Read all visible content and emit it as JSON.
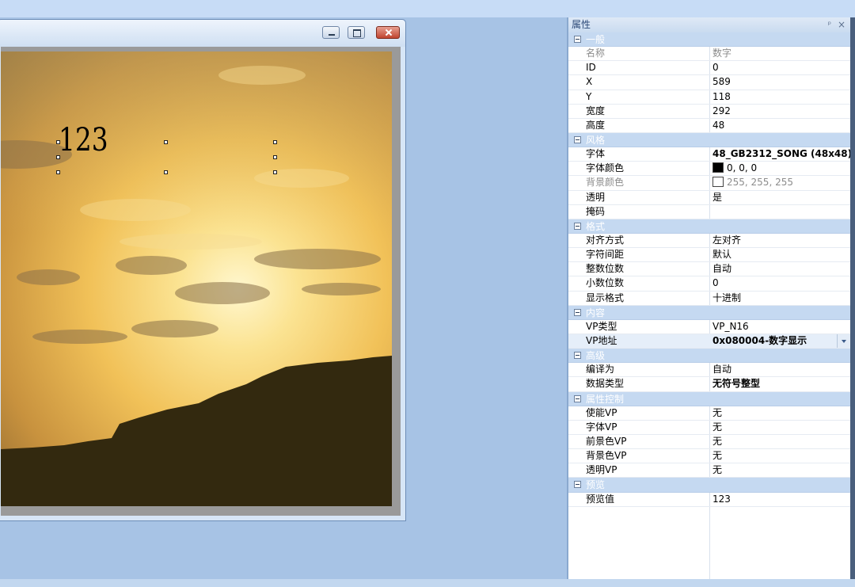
{
  "panel": {
    "title": "属性",
    "pin_glyph": "ᵖ",
    "close_glyph": "×"
  },
  "widget": {
    "text": "123"
  },
  "categories": {
    "general": "一般",
    "style": "风格",
    "format": "格式",
    "content": "内容",
    "advanced": "高级",
    "control": "属性控制",
    "preview": "预览"
  },
  "props": {
    "name": {
      "label": "名称",
      "value": "数字"
    },
    "id": {
      "label": "ID",
      "value": "0"
    },
    "x": {
      "label": "X",
      "value": "589"
    },
    "y": {
      "label": "Y",
      "value": "118"
    },
    "width": {
      "label": "宽度",
      "value": "292"
    },
    "height": {
      "label": "高度",
      "value": "48"
    },
    "font": {
      "label": "字体",
      "value": "48_GB2312_SONG (48x48)"
    },
    "font_color": {
      "label": "字体颜色",
      "value": "0, 0, 0",
      "color": "#000000"
    },
    "bg_color": {
      "label": "背景颜色",
      "value": "255, 255, 255",
      "color": "#ffffff"
    },
    "transparent": {
      "label": "透明",
      "value": "是"
    },
    "mask": {
      "label": "掩码",
      "value": ""
    },
    "align": {
      "label": "对齐方式",
      "value": "左对齐"
    },
    "spacing": {
      "label": "字符间距",
      "value": "默认"
    },
    "int_digits": {
      "label": "整数位数",
      "value": "自动"
    },
    "dec_digits": {
      "label": "小数位数",
      "value": "0"
    },
    "display_format": {
      "label": "显示格式",
      "value": "十进制"
    },
    "vp_type": {
      "label": "VP类型",
      "value": "VP_N16"
    },
    "vp_addr": {
      "label": "VP地址",
      "value": "0x080004-数字显示"
    },
    "compile_as": {
      "label": "编译为",
      "value": "自动"
    },
    "data_type": {
      "label": "数据类型",
      "value": "无符号整型"
    },
    "enable_vp": {
      "label": "使能VP",
      "value": "无"
    },
    "font_vp": {
      "label": "字体VP",
      "value": "无"
    },
    "fg_vp": {
      "label": "前景色VP",
      "value": "无"
    },
    "bg_vp": {
      "label": "背景色VP",
      "value": "无"
    },
    "trans_vp": {
      "label": "透明VP",
      "value": "无"
    },
    "preview_value": {
      "label": "预览值",
      "value": "123"
    }
  },
  "colors": {
    "workspace": "#a7c3e5",
    "category": "#c5d9f1",
    "accent": "#2d4a78"
  }
}
